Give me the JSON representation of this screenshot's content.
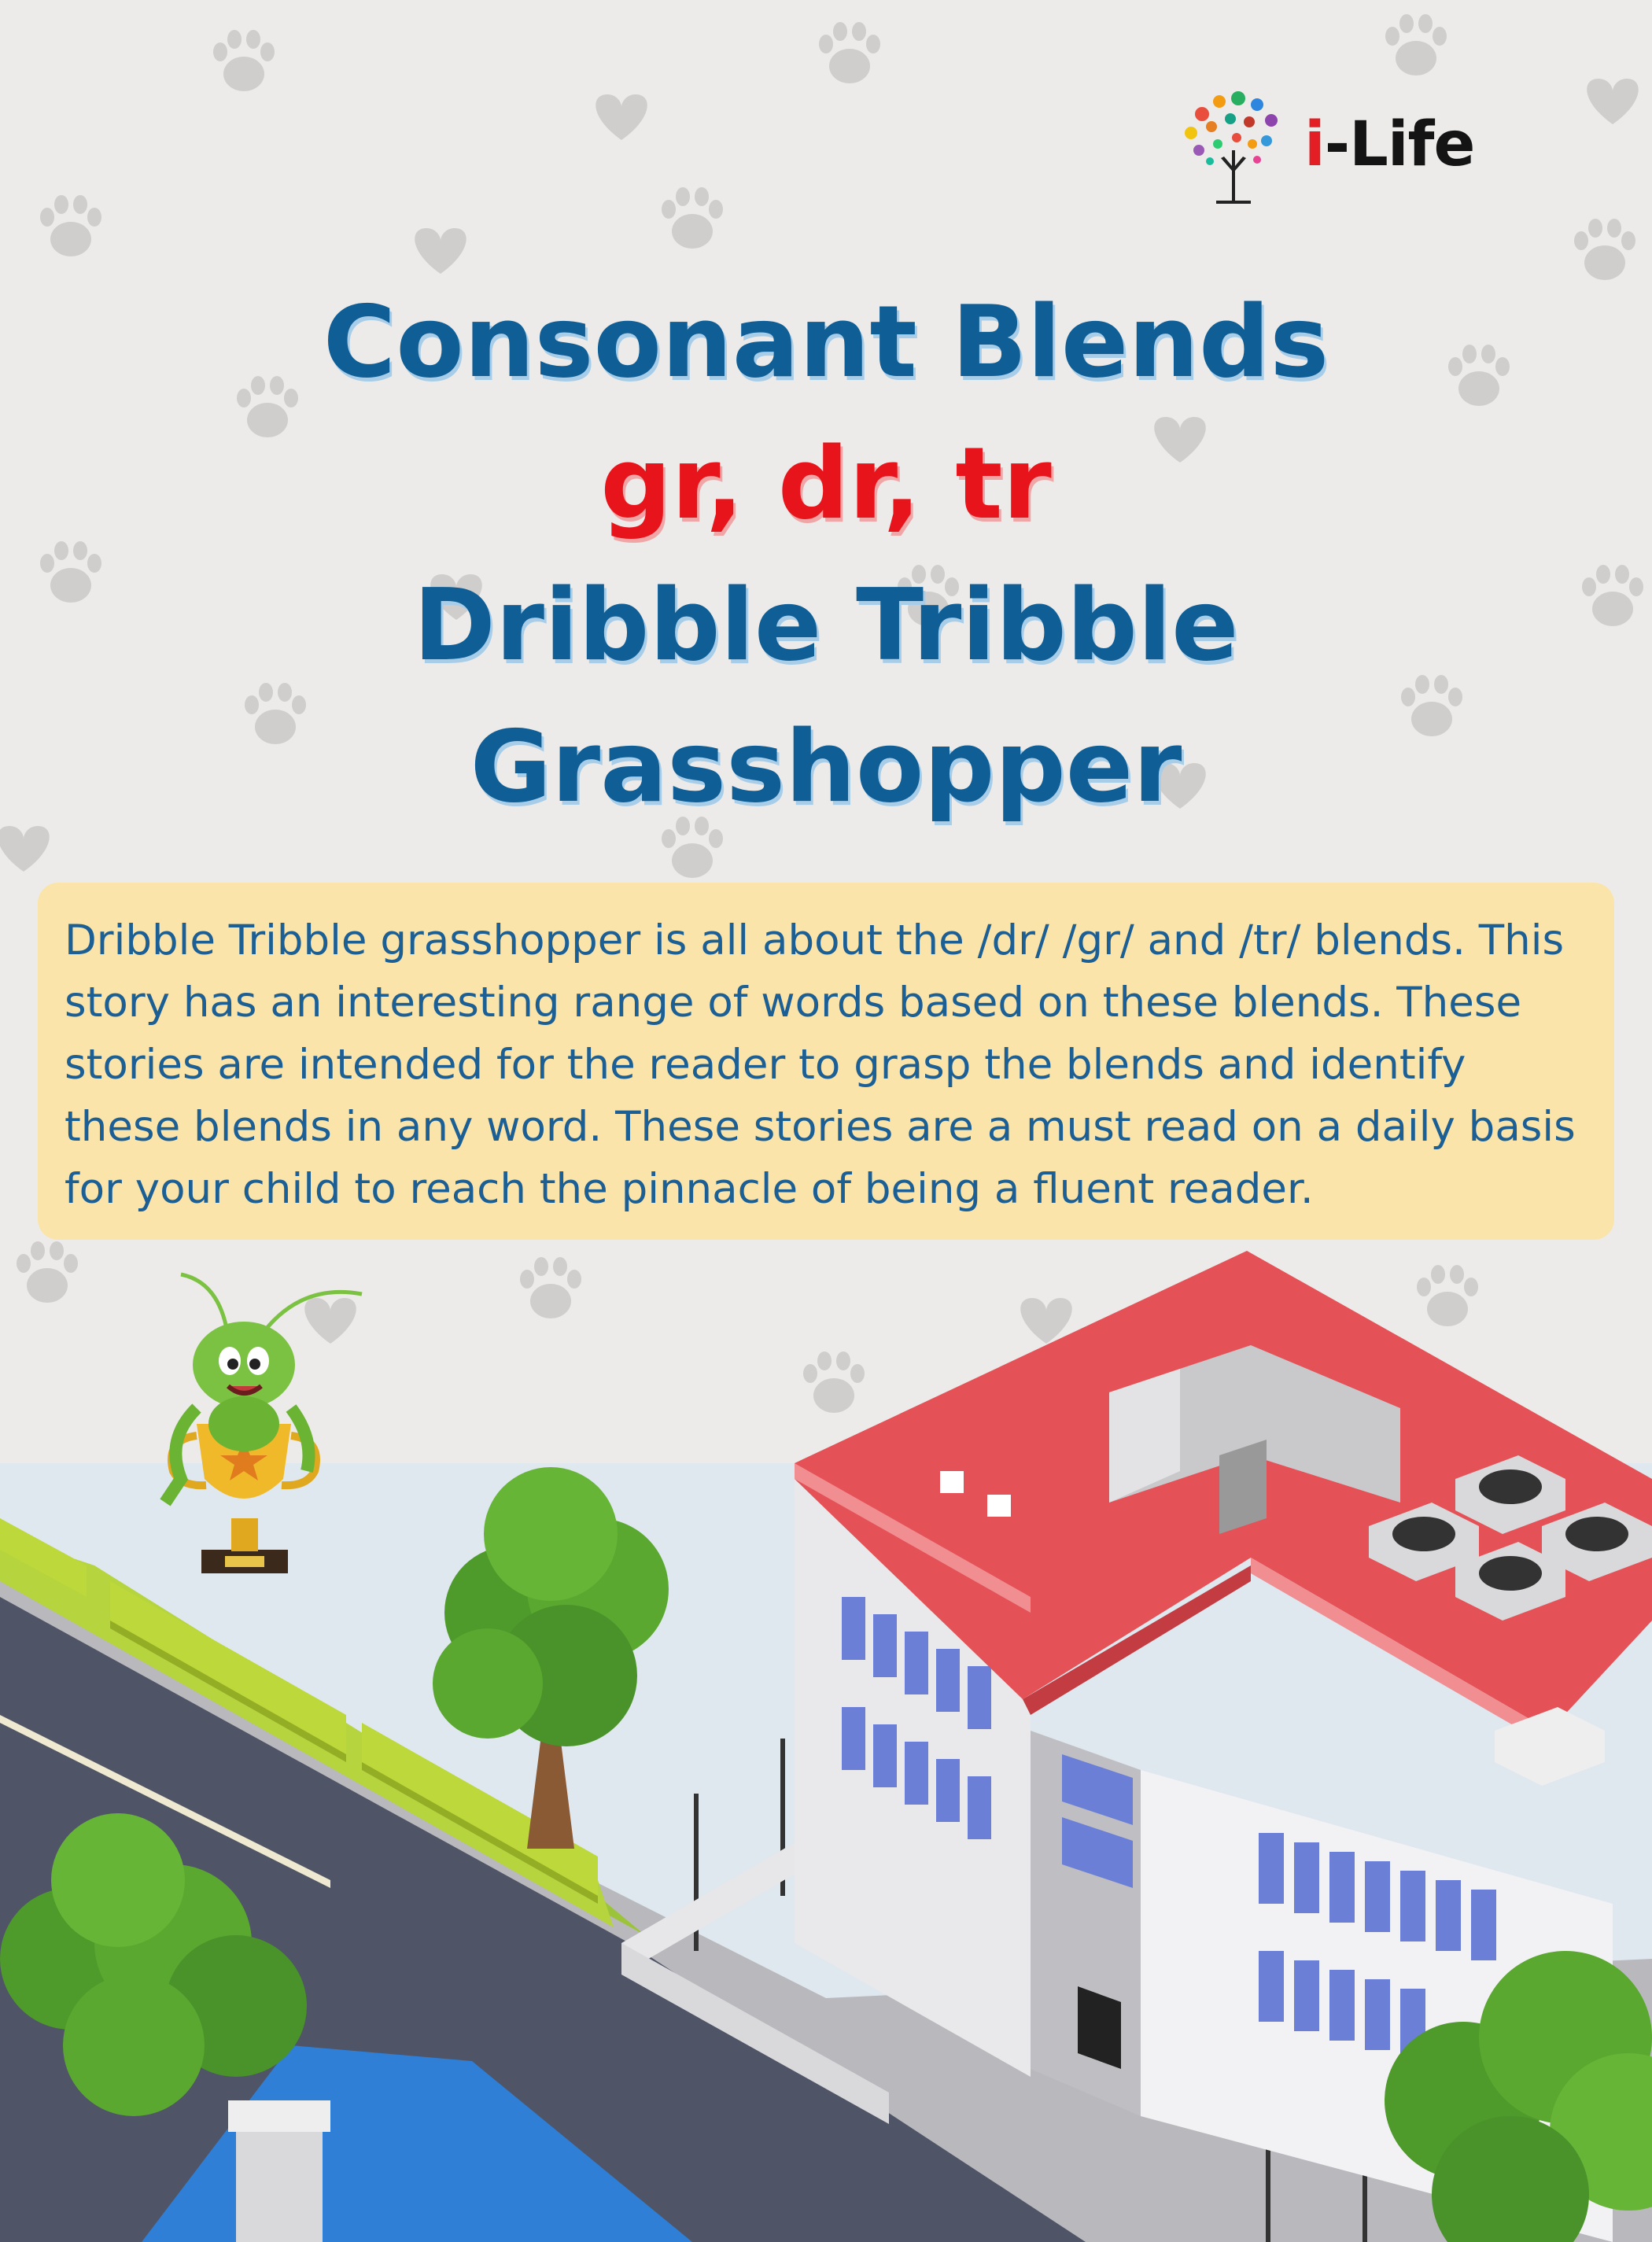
{
  "brand": {
    "logo_i": "i",
    "logo_rest": "-Life"
  },
  "title": {
    "line1": "Consonant Blends",
    "line2": "gr, dr, tr",
    "line3": "Dribble Tribble",
    "line4": "Grasshopper"
  },
  "description": "Dribble Tribble grasshopper is all about the /dr/ /gr/ and /tr/ blends. This story has an interesting range of words based on these blends. These stories are intended for the reader to grasp the blends and identify these blends in any word. These stories are a must read on a daily basis for your child to reach the pinnacle of being a fluent reader.",
  "colors": {
    "title_blue": "#0f5e95",
    "title_red": "#e8141b",
    "box_yellow": "#fae4a9",
    "text_blue": "#1c5f95",
    "roof_red": "#e45156"
  },
  "icons": [
    "tree-logo-icon",
    "paw-print-icon",
    "heart-icon",
    "grasshopper-icon",
    "trophy-icon"
  ]
}
